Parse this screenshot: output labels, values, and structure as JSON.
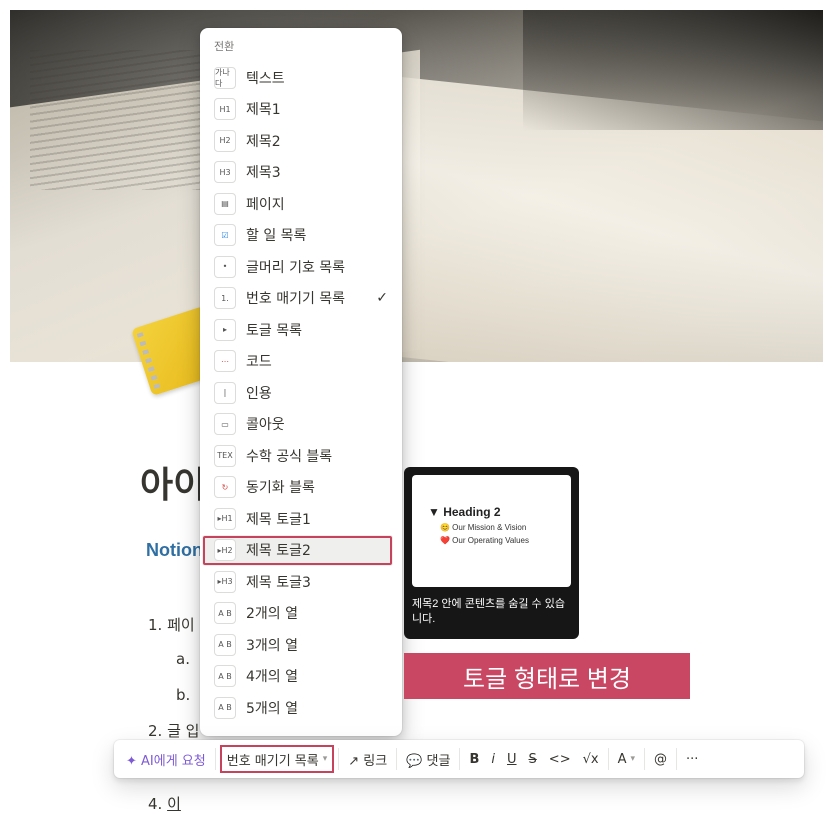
{
  "menu": {
    "header": "전환",
    "items": [
      {
        "icon": "가나다",
        "label": "텍스트"
      },
      {
        "icon": "H1",
        "label": "제목1"
      },
      {
        "icon": "H2",
        "label": "제목2"
      },
      {
        "icon": "H3",
        "label": "제목3"
      },
      {
        "icon": "▤",
        "label": "페이지"
      },
      {
        "icon": "☑",
        "label": "할 일 목록"
      },
      {
        "icon": "•",
        "label": "글머리 기호 목록"
      },
      {
        "icon": "1.",
        "label": "번호 매기기 목록",
        "checked": "✓"
      },
      {
        "icon": "▸",
        "label": "토글 목록"
      },
      {
        "icon": "⋯",
        "label": "코드"
      },
      {
        "icon": "|",
        "label": "인용"
      },
      {
        "icon": "▭",
        "label": "콜아웃"
      },
      {
        "icon": "TEX",
        "label": "수학 공식 블록"
      },
      {
        "icon": "↻",
        "label": "동기화 블록"
      },
      {
        "icon": "▸H1",
        "label": "제목 토글1"
      },
      {
        "icon": "▸H2",
        "label": "제목 토글2"
      },
      {
        "icon": "▸H3",
        "label": "제목 토글3"
      },
      {
        "icon": "A B",
        "label": "2개의 열"
      },
      {
        "icon": "A B",
        "label": "3개의 열"
      },
      {
        "icon": "A B",
        "label": "4개의 열"
      },
      {
        "icon": "A B",
        "label": "5개의 열"
      }
    ]
  },
  "page": {
    "title": "아이",
    "subtitle": "Notion",
    "list": [
      {
        "marker": "1.",
        "text": "페이"
      },
      {
        "marker": "a.",
        "text": ""
      },
      {
        "marker": "b.",
        "text": ""
      },
      {
        "marker": "2.",
        "text": "글 입"
      },
      {
        "marker": "4.",
        "text": "이"
      }
    ]
  },
  "preview": {
    "heading": "▼  Heading 2",
    "line1": "😊 Our Mission & Vision",
    "line2": "❤️ Our Operating Values",
    "description": "제목2 안에 콘텐츠를 숨길 수 있습니다."
  },
  "banner": "토글 형태로 변경",
  "toolbar": {
    "ai": "✦ AI에게 요청",
    "block_type": "번호 매기기 목록",
    "link": "↗ 링크",
    "comment": "💬 댓글",
    "bold": "B",
    "italic": "i",
    "underline": "U",
    "strike": "S",
    "code": "<>",
    "math": "√x",
    "color": "A",
    "mention": "@",
    "more": "···"
  }
}
